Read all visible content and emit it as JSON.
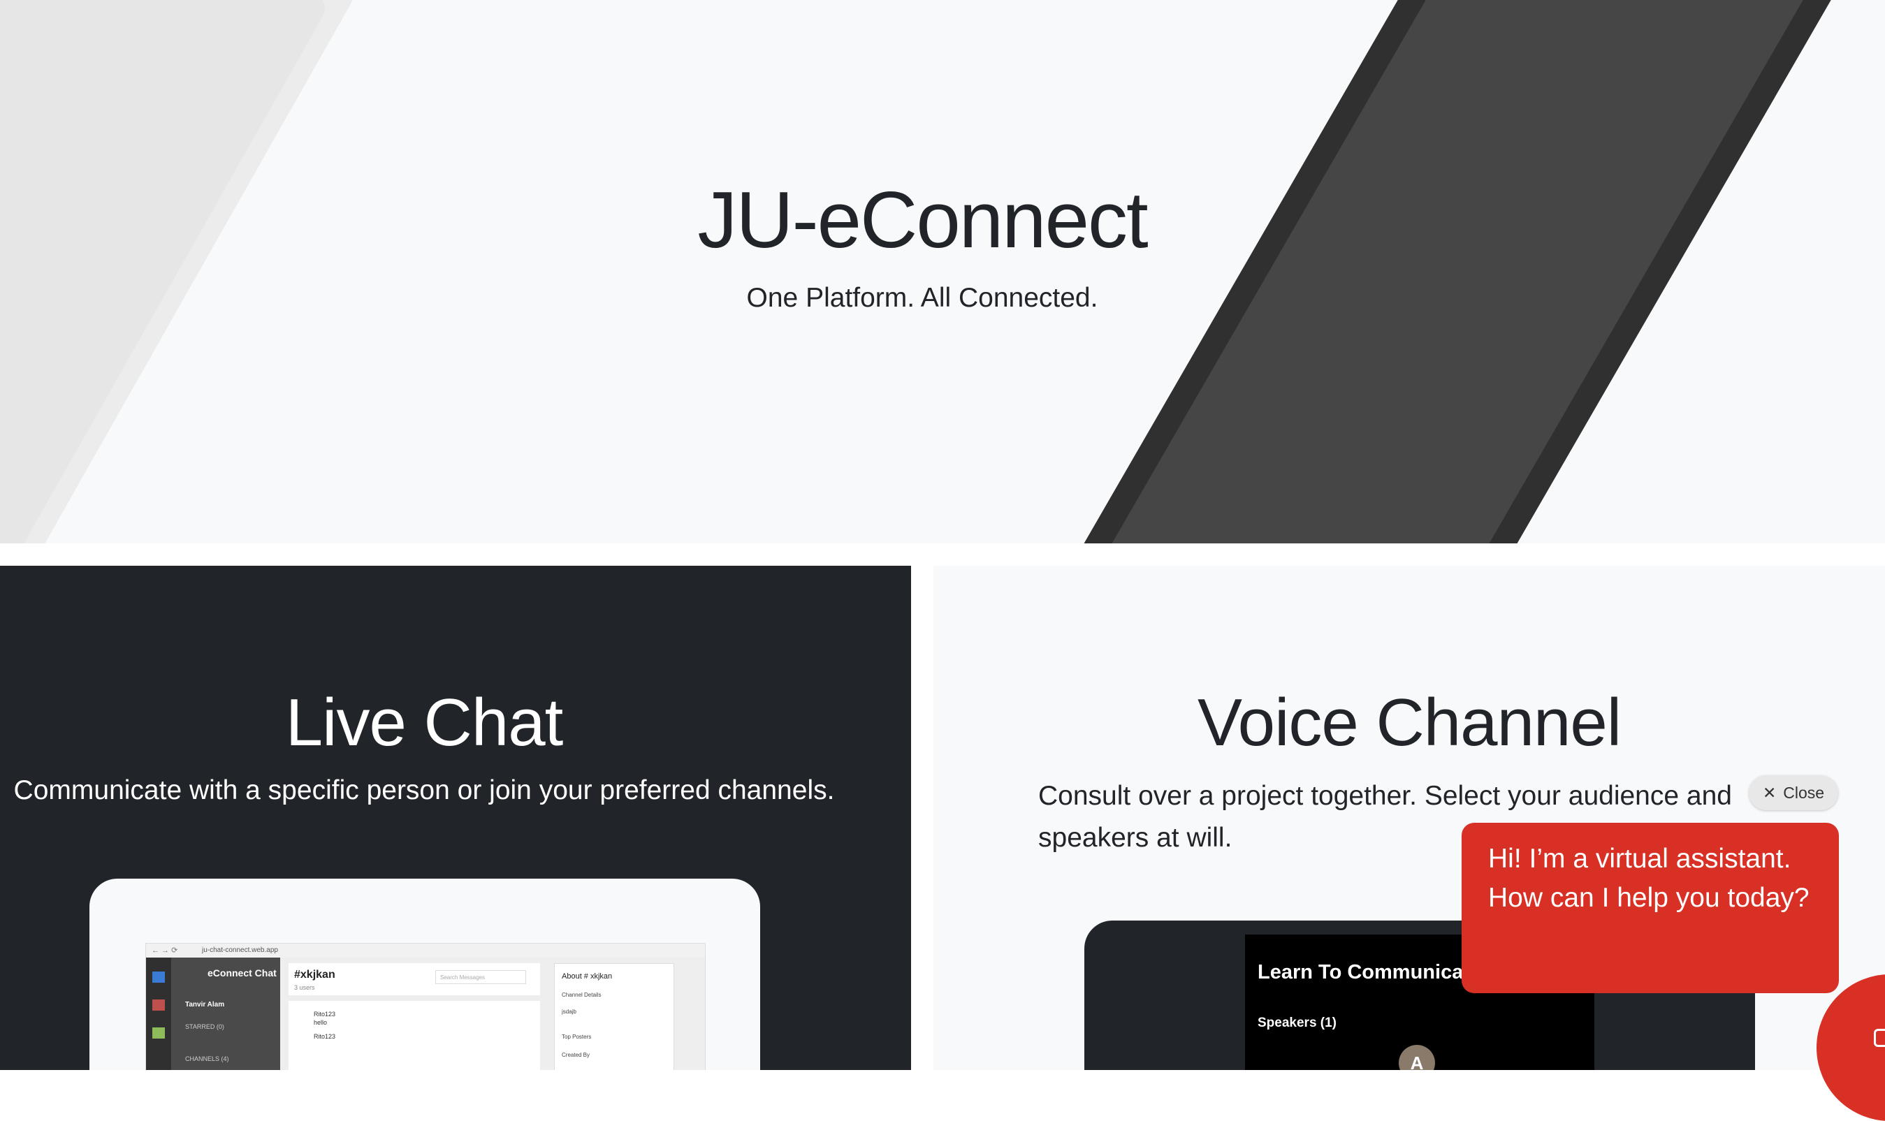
{
  "hero": {
    "title": "JU-eConnect",
    "subtitle": "One Platform. All Connected."
  },
  "live_chat": {
    "title": "Live Chat",
    "description": "Communicate with a specific person or join your preferred channels.",
    "screenshot": {
      "url": "ju-chat-connect.web.app",
      "brand": "eConnect Chat",
      "user": "Tanvir Alam",
      "starred": "STARRED (0)",
      "channels": "CHANNELS (4)",
      "channel_name": "#xkjkan",
      "users_count": "3 users",
      "search_placeholder": "Search Messages",
      "messages": [
        {
          "author": "Rito123",
          "text": "hello"
        },
        {
          "author": "Rito123",
          "text": ""
        }
      ],
      "about_title": "About # xkjkan",
      "about_rows": [
        "Channel Details",
        "jsdajb",
        "Top Posters",
        "Created By"
      ]
    }
  },
  "voice_channel": {
    "title": "Voice Channel",
    "description": "Consult over a project together. Select your audience and speakers at will.",
    "screenshot": {
      "room_title": "Learn To Communicate",
      "speakers_label": "Speakers (1)",
      "avatar_letter": "A"
    }
  },
  "assistant_widget": {
    "close_label": "Close",
    "message": "Hi! I’m a virtual assistant. How can I help you today?",
    "accent_color": "#d93025",
    "icons": [
      "close-icon",
      "chat-icon"
    ]
  }
}
